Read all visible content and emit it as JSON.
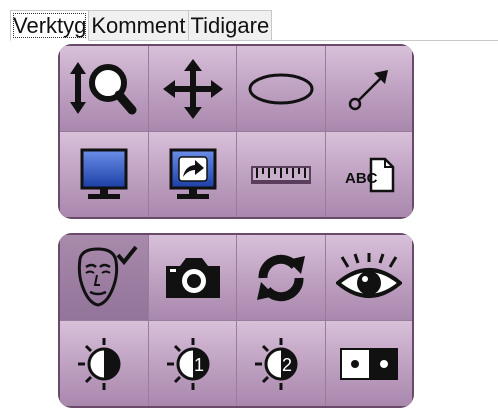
{
  "tabs": [
    {
      "label": "Verktyg",
      "active": true
    },
    {
      "label": "Komment",
      "active": false
    },
    {
      "label": "Tidigare",
      "active": false
    }
  ],
  "tool_panel": {
    "rows": [
      [
        {
          "icon": "zoom-icon"
        },
        {
          "icon": "pan-icon"
        },
        {
          "icon": "ellipse-icon"
        },
        {
          "icon": "arrow-icon"
        }
      ],
      [
        {
          "icon": "monitor-icon"
        },
        {
          "icon": "monitor-share-icon"
        },
        {
          "icon": "ruler-icon"
        },
        {
          "icon": "text-annotation-icon",
          "text": "ABC"
        }
      ]
    ]
  },
  "display_panel": {
    "rows": [
      [
        {
          "icon": "face-check-icon",
          "selected": true
        },
        {
          "icon": "camera-icon"
        },
        {
          "icon": "refresh-icon"
        },
        {
          "icon": "eye-icon"
        }
      ],
      [
        {
          "icon": "contrast-icon"
        },
        {
          "icon": "contrast-1-icon",
          "text": "1"
        },
        {
          "icon": "contrast-2-icon",
          "text": "2"
        },
        {
          "icon": "dual-view-icon"
        }
      ]
    ]
  },
  "colors": {
    "panel": "#bd9fc0",
    "panel_dark": "#6a4a6b",
    "selected": "#93749a"
  }
}
